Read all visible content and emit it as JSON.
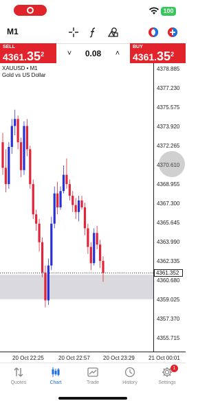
{
  "status_bar": {
    "battery": "100"
  },
  "toolbar": {
    "timeframe": "M1"
  },
  "trade": {
    "sell": {
      "label": "SELL",
      "price_prefix": "4361.",
      "price_big": "35",
      "price_sup": "2"
    },
    "buy": {
      "label": "BUY",
      "price_prefix": "4361.",
      "price_big": "35",
      "price_sup": "2"
    },
    "volume": "0.08",
    "vol_down": "˅",
    "vol_up": "˄"
  },
  "chart": {
    "symbol": "XAUUSD • M1",
    "description": "Gold vs US Dollar",
    "price_ticks": [
      "4378.885",
      "4377.230",
      "4375.575",
      "4373.920",
      "4372.265",
      "4370.610",
      "4368.955",
      "4367.300",
      "4365.645",
      "4363.990",
      "4362.335",
      "4360.680",
      "4359.025",
      "4357.370",
      "4355.715"
    ],
    "current_price": "4361.352",
    "time_ticks": [
      "20 Oct 22:25",
      "20 Oct 22:57",
      "20 Oct 23:29",
      "21 Oct 00:01"
    ]
  },
  "chart_data": {
    "type": "candlestick",
    "ylim": [
      4354.6,
      4379.4
    ],
    "candles": [
      [
        4372.6,
        4373.4,
        4369.8,
        4370.4
      ],
      [
        4370.4,
        4372.0,
        4368.3,
        4369.0
      ],
      [
        4369.0,
        4372.6,
        4368.6,
        4372.2
      ],
      [
        4372.2,
        4374.6,
        4371.6,
        4374.0
      ],
      [
        4374.0,
        4375.4,
        4373.2,
        4374.6
      ],
      [
        4374.6,
        4374.9,
        4372.0,
        4372.6
      ],
      [
        4372.6,
        4373.0,
        4369.6,
        4370.2
      ],
      [
        4370.2,
        4374.4,
        4369.8,
        4374.0
      ],
      [
        4374.0,
        4374.6,
        4371.4,
        4372.0
      ],
      [
        4372.0,
        4372.3,
        4368.6,
        4369.0
      ],
      [
        4369.0,
        4369.4,
        4366.0,
        4366.4
      ],
      [
        4366.4,
        4366.8,
        4365.0,
        4365.6
      ],
      [
        4365.6,
        4366.0,
        4363.2,
        4364.0
      ],
      [
        4364.0,
        4364.4,
        4361.0,
        4361.4
      ],
      [
        4361.4,
        4362.0,
        4358.4,
        4359.0
      ],
      [
        4359.0,
        4362.6,
        4358.6,
        4362.0
      ],
      [
        4362.0,
        4366.2,
        4361.6,
        4365.6
      ],
      [
        4365.6,
        4368.8,
        4365.2,
        4368.2
      ],
      [
        4368.2,
        4369.2,
        4366.4,
        4367.0
      ],
      [
        4367.0,
        4368.8,
        4366.8,
        4368.4
      ],
      [
        4368.4,
        4370.6,
        4368.2,
        4369.8
      ],
      [
        4369.8,
        4371.2,
        4368.6,
        4369.0
      ],
      [
        4369.0,
        4369.4,
        4367.6,
        4368.0
      ],
      [
        4368.0,
        4368.4,
        4366.6,
        4367.2
      ],
      [
        4367.2,
        4367.8,
        4366.0,
        4366.6
      ],
      [
        4366.6,
        4368.0,
        4365.8,
        4367.6
      ],
      [
        4367.6,
        4368.0,
        4366.8,
        4367.0
      ],
      [
        4367.0,
        4367.4,
        4364.6,
        4365.2
      ],
      [
        4365.2,
        4365.6,
        4363.0,
        4363.6
      ],
      [
        4363.6,
        4364.0,
        4361.6,
        4362.2
      ],
      [
        4362.2,
        4365.2,
        4362.0,
        4364.8
      ],
      [
        4364.8,
        4365.4,
        4363.4,
        4363.8
      ],
      [
        4363.8,
        4364.2,
        4361.8,
        4362.4
      ],
      [
        4362.4,
        4362.8,
        4360.6,
        4361.35
      ]
    ],
    "bull_color": "#2b2fd6",
    "bear_color": "#e0243a",
    "highlight_band": [
      4359.1,
      4361.2
    ]
  },
  "tabs": [
    {
      "label": "Quotes",
      "icon": "arrows-updown-icon"
    },
    {
      "label": "Chart",
      "icon": "candles-icon"
    },
    {
      "label": "Trade",
      "icon": "trend-icon"
    },
    {
      "label": "History",
      "icon": "clock-icon"
    },
    {
      "label": "Settings",
      "icon": "gear-icon",
      "badge": "1"
    }
  ]
}
